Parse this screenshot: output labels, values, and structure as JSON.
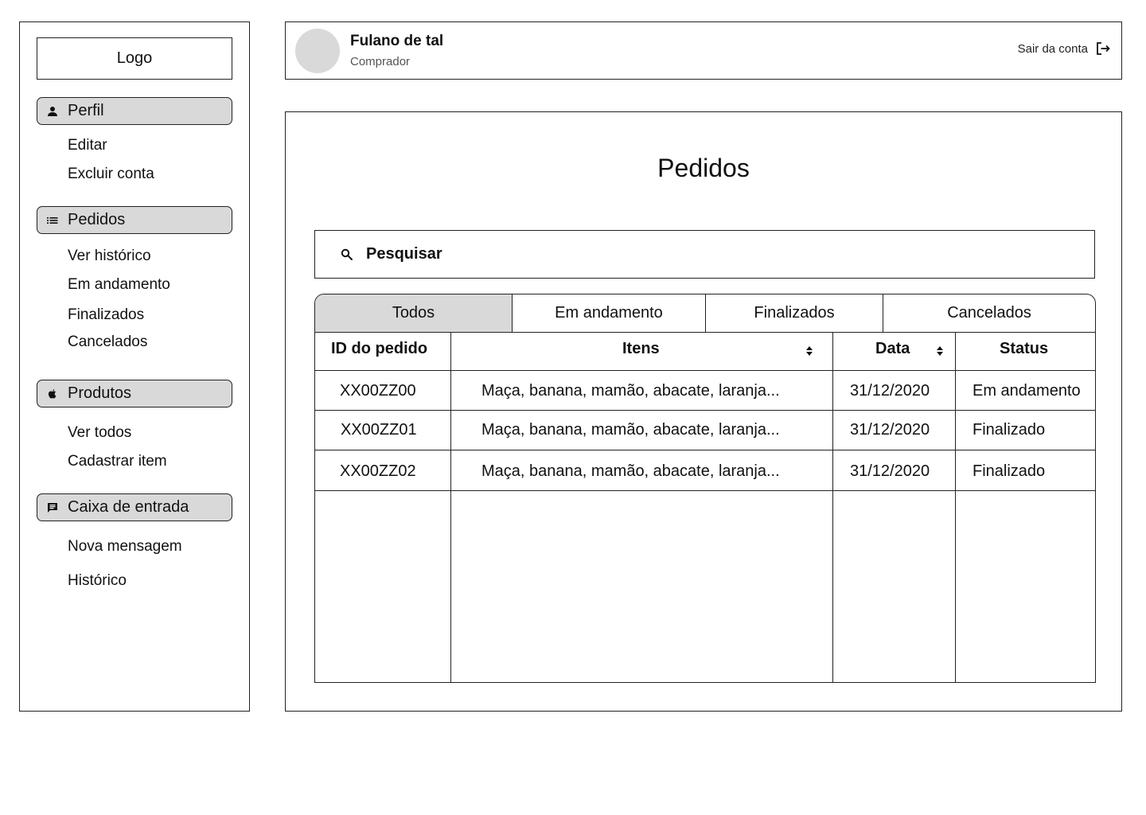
{
  "sidebar": {
    "logo": "Logo",
    "sections": [
      {
        "label": "Perfil",
        "icon": "person-icon",
        "items": [
          "Editar",
          "Excluir conta"
        ]
      },
      {
        "label": "Pedidos",
        "icon": "list-icon",
        "items": [
          "Ver histórico",
          "Em andamento",
          "Finalizados",
          "Cancelados"
        ]
      },
      {
        "label": "Produtos",
        "icon": "apple-icon",
        "items": [
          "Ver todos",
          "Cadastrar item"
        ]
      },
      {
        "label": "Caixa de entrada",
        "icon": "message-icon",
        "items": [
          "Nova mensagem",
          "Histórico"
        ]
      }
    ]
  },
  "header": {
    "user_name": "Fulano de tal",
    "user_role": "Comprador",
    "logout_label": "Sair da conta",
    "logout_icon": "logout-icon"
  },
  "main": {
    "title": "Pedidos",
    "search": {
      "placeholder": "Pesquisar",
      "icon": "search-icon"
    },
    "tabs": [
      {
        "label": "Todos",
        "active": true
      },
      {
        "label": "Em andamento",
        "active": false
      },
      {
        "label": "Finalizados",
        "active": false
      },
      {
        "label": "Cancelados",
        "active": false
      }
    ],
    "table": {
      "columns": [
        "ID do pedido",
        "Itens",
        "Data",
        "Status"
      ],
      "rows": [
        [
          "XX00ZZ00",
          "Maça, banana, mamão, abacate, laranja...",
          "31/12/2020",
          "Em andamento"
        ],
        [
          "XX00ZZ01",
          "Maça, banana, mamão, abacate, laranja...",
          "31/12/2020",
          "Finalizado"
        ],
        [
          "XX00ZZ02",
          "Maça, banana, mamão, abacate, laranja...",
          "31/12/2020",
          "Finalizado"
        ]
      ]
    }
  },
  "colors": {
    "section_bg": "#d9d9d9",
    "border": "#222222",
    "avatar": "#d9d9d9"
  }
}
